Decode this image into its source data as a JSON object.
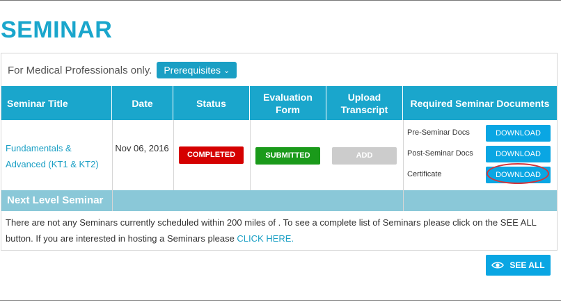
{
  "page": {
    "title": "SEMINAR"
  },
  "intro": {
    "text": "For Medical Professionals only.",
    "prereq_label": "Prerequisites",
    "prereq_chevron": "⌄"
  },
  "table": {
    "headers": [
      "Seminar Title",
      "Date",
      "Status",
      "Evaluation Form",
      "Upload Transcript",
      "Required Seminar Documents"
    ],
    "header_color": "#1aa6cc",
    "row": {
      "seminar_title": "Fundamentals & Advanced (KT1 & KT2)",
      "date": "Nov 06, 2016",
      "status": "COMPLETED",
      "evaluation": "SUBMITTED",
      "upload": "ADD",
      "documents": [
        {
          "label": "Pre-Seminar Docs",
          "button": "DOWNLOAD"
        },
        {
          "label": "Post-Seminar Docs",
          "button": "DOWNLOAD"
        },
        {
          "label": "Certificate",
          "button": "DOWNLOAD"
        }
      ]
    }
  },
  "next_level": {
    "label": "Next Level Seminar",
    "message": "There are not any Seminars currently scheduled within 200 miles of . To see a complete list of Seminars please click on the SEE ALL button. If you are interested in hosting a Seminars please ",
    "link": "CLICK HERE."
  },
  "actions": {
    "see_all": "SEE ALL"
  },
  "colors": {
    "accent": "#1aa6cc",
    "completed": "#d50000",
    "submitted": "#1a9a1a",
    "disabled": "#cccccc",
    "download": "#0aa6e3",
    "next_bar": "#8ac8d8",
    "highlight": "#d5353a"
  }
}
